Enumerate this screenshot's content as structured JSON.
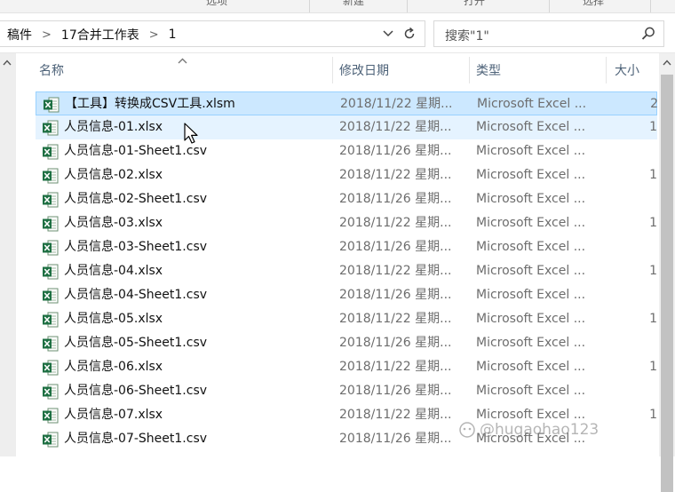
{
  "ribbon": {
    "items": [
      "选项",
      "新建",
      "打开",
      "选择"
    ]
  },
  "address": {
    "breadcrumb": [
      "稿件",
      "17合并工作表",
      "1"
    ],
    "search_placeholder": "搜索\"1\""
  },
  "columns": {
    "name": "名称",
    "date": "修改日期",
    "type": "类型",
    "size": "大小"
  },
  "files": [
    {
      "name": "【工具】转换成CSV工具.xlsm",
      "date": "2018/11/22 星期...",
      "type": "Microsoft Excel ...",
      "size": "2",
      "state": "selected"
    },
    {
      "name": "人员信息-01.xlsx",
      "date": "2018/11/22 星期...",
      "type": "Microsoft Excel ...",
      "size": "1",
      "state": "hover"
    },
    {
      "name": "人员信息-01-Sheet1.csv",
      "date": "2018/11/26 星期...",
      "type": "Microsoft Excel ...",
      "size": "",
      "state": ""
    },
    {
      "name": "人员信息-02.xlsx",
      "date": "2018/11/22 星期...",
      "type": "Microsoft Excel ...",
      "size": "1",
      "state": ""
    },
    {
      "name": "人员信息-02-Sheet1.csv",
      "date": "2018/11/26 星期...",
      "type": "Microsoft Excel ...",
      "size": "",
      "state": ""
    },
    {
      "name": "人员信息-03.xlsx",
      "date": "2018/11/22 星期...",
      "type": "Microsoft Excel ...",
      "size": "1",
      "state": ""
    },
    {
      "name": "人员信息-03-Sheet1.csv",
      "date": "2018/11/26 星期...",
      "type": "Microsoft Excel ...",
      "size": "",
      "state": ""
    },
    {
      "name": "人员信息-04.xlsx",
      "date": "2018/11/22 星期...",
      "type": "Microsoft Excel ...",
      "size": "1",
      "state": ""
    },
    {
      "name": "人员信息-04-Sheet1.csv",
      "date": "2018/11/26 星期...",
      "type": "Microsoft Excel ...",
      "size": "",
      "state": ""
    },
    {
      "name": "人员信息-05.xlsx",
      "date": "2018/11/22 星期...",
      "type": "Microsoft Excel ...",
      "size": "1",
      "state": ""
    },
    {
      "name": "人员信息-05-Sheet1.csv",
      "date": "2018/11/26 星期...",
      "type": "Microsoft Excel ...",
      "size": "",
      "state": ""
    },
    {
      "name": "人员信息-06.xlsx",
      "date": "2018/11/22 星期...",
      "type": "Microsoft Excel ...",
      "size": "1",
      "state": ""
    },
    {
      "name": "人员信息-06-Sheet1.csv",
      "date": "2018/11/26 星期...",
      "type": "Microsoft Excel ...",
      "size": "",
      "state": ""
    },
    {
      "name": "人员信息-07.xlsx",
      "date": "2018/11/22 星期...",
      "type": "Microsoft Excel ...",
      "size": "1",
      "state": ""
    },
    {
      "name": "人员信息-07-Sheet1.csv",
      "date": "2018/11/26 星期...",
      "type": "Microsoft Excel ...",
      "size": "",
      "state": ""
    }
  ],
  "watermark": "@hugaohao123",
  "colors": {
    "selected_bg": "#cce8ff",
    "hover_bg": "#e5f3ff",
    "excel_green": "#1d6f42",
    "header_text": "#4d6278"
  }
}
